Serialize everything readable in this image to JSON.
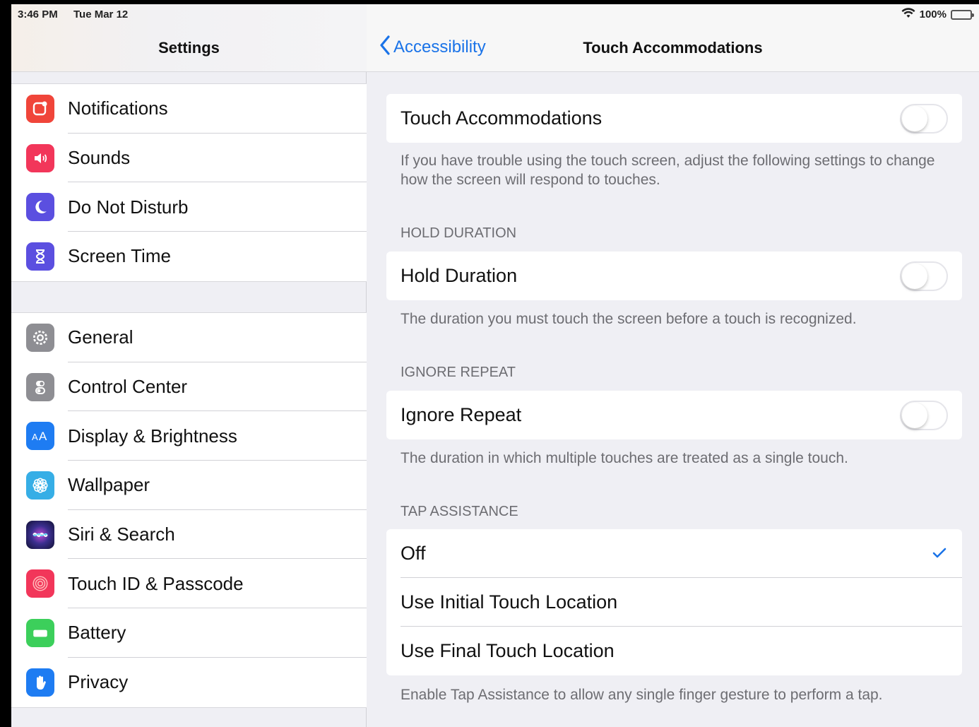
{
  "status": {
    "time": "3:46 PM",
    "date": "Tue Mar 12",
    "battery": "100%"
  },
  "sidebar": {
    "title": "Settings",
    "group1": [
      {
        "label": "Notifications",
        "icon": "notifications-icon",
        "color": "#f0453a"
      },
      {
        "label": "Sounds",
        "icon": "sounds-icon",
        "color": "#f2365a"
      },
      {
        "label": "Do Not Disturb",
        "icon": "moon-icon",
        "color": "#5b4fe0"
      },
      {
        "label": "Screen Time",
        "icon": "hourglass-icon",
        "color": "#5b4fe0"
      }
    ],
    "group2": [
      {
        "label": "General",
        "icon": "gear-icon",
        "color": "#8e8e93"
      },
      {
        "label": "Control Center",
        "icon": "switches-icon",
        "color": "#8e8e93"
      },
      {
        "label": "Display & Brightness",
        "icon": "aa-icon",
        "color": "#1e7cf2"
      },
      {
        "label": "Wallpaper",
        "icon": "flower-icon",
        "color": "#36aee6"
      },
      {
        "label": "Siri & Search",
        "icon": "siri-icon",
        "color": "#1b1b3a"
      },
      {
        "label": "Touch ID & Passcode",
        "icon": "fingerprint-icon",
        "color": "#f2365a"
      },
      {
        "label": "Battery",
        "icon": "battery-icon",
        "color": "#3ccf5b"
      },
      {
        "label": "Privacy",
        "icon": "hand-icon",
        "color": "#1e7cf2"
      }
    ]
  },
  "detail": {
    "back_label": "Accessibility",
    "title": "Touch Accommodations",
    "touch_accommodations": {
      "label": "Touch Accommodations",
      "on": false,
      "footer": "If you have trouble using the touch screen, adjust the following settings to change how the screen will respond to touches."
    },
    "hold_duration": {
      "header": "HOLD DURATION",
      "label": "Hold Duration",
      "on": false,
      "footer": "The duration you must touch the screen before a touch is recognized."
    },
    "ignore_repeat": {
      "header": "IGNORE REPEAT",
      "label": "Ignore Repeat",
      "on": false,
      "footer": "The duration in which multiple touches are treated as a single touch."
    },
    "tap_assistance": {
      "header": "TAP ASSISTANCE",
      "options": [
        "Off",
        "Use Initial Touch Location",
        "Use Final Touch Location"
      ],
      "selected": "Off",
      "footer": "Enable Tap Assistance to allow any single finger gesture to perform a tap."
    }
  }
}
